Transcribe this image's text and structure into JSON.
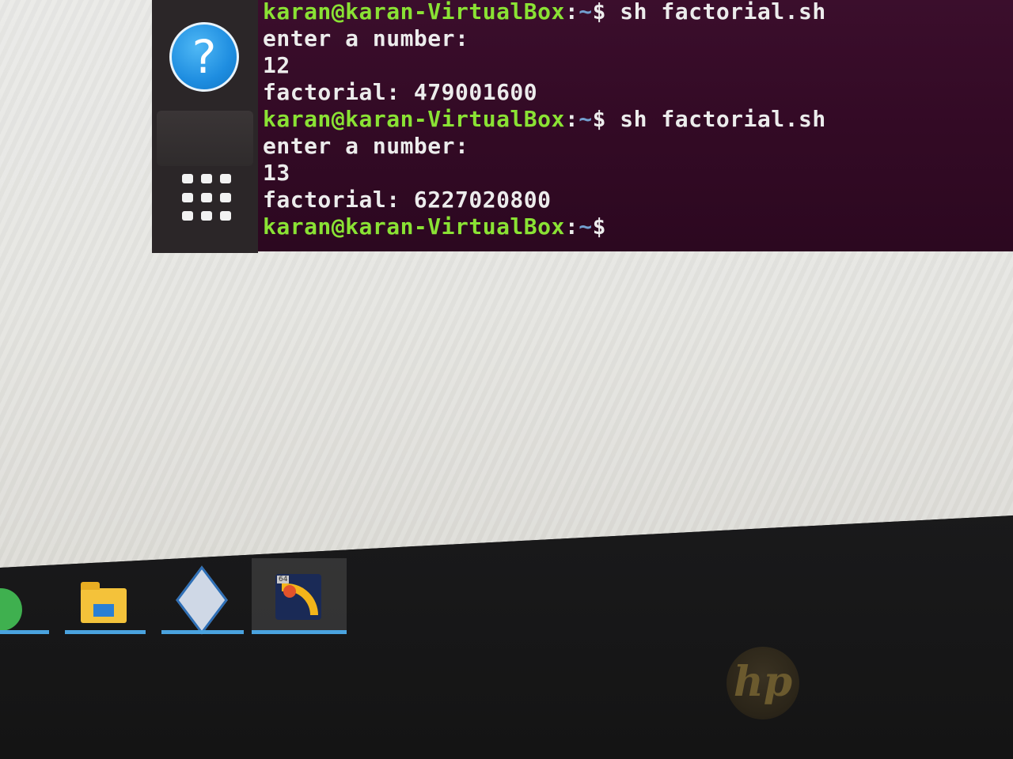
{
  "terminal": {
    "lines": [
      {
        "user": "karan@karan-VirtualBox",
        "colon": ":",
        "path": "~",
        "dollar": "$",
        "command": " sh factorial.sh"
      },
      {
        "text": "enter a number:"
      },
      {
        "text": "12"
      },
      {
        "text": "factorial: 479001600"
      },
      {
        "user": "karan@karan-VirtualBox",
        "colon": ":",
        "path": "~",
        "dollar": "$",
        "command": " sh factorial.sh"
      },
      {
        "text": "enter a number:"
      },
      {
        "text": "13"
      },
      {
        "text": "factorial: 6227020800"
      },
      {
        "user": "karan@karan-VirtualBox",
        "colon": ":",
        "path": "~",
        "dollar": "$",
        "command": ""
      }
    ]
  },
  "dock": {
    "help_glyph": "?",
    "icons": [
      "help-icon",
      "blank-app-icon",
      "show-applications-icon"
    ]
  },
  "taskbar": {
    "items": [
      {
        "name": "qt-creator-icon"
      },
      {
        "name": "file-explorer-icon"
      },
      {
        "name": "virtualbox-icon"
      },
      {
        "name": "app-64bit-icon",
        "badge": "64"
      }
    ]
  },
  "bezel": {
    "brand": "hp"
  },
  "colors": {
    "terminal_bg": "#300a24",
    "prompt_user": "#8ae234",
    "prompt_path": "#729fcf",
    "taskbar_indicator": "#4aa3df"
  }
}
